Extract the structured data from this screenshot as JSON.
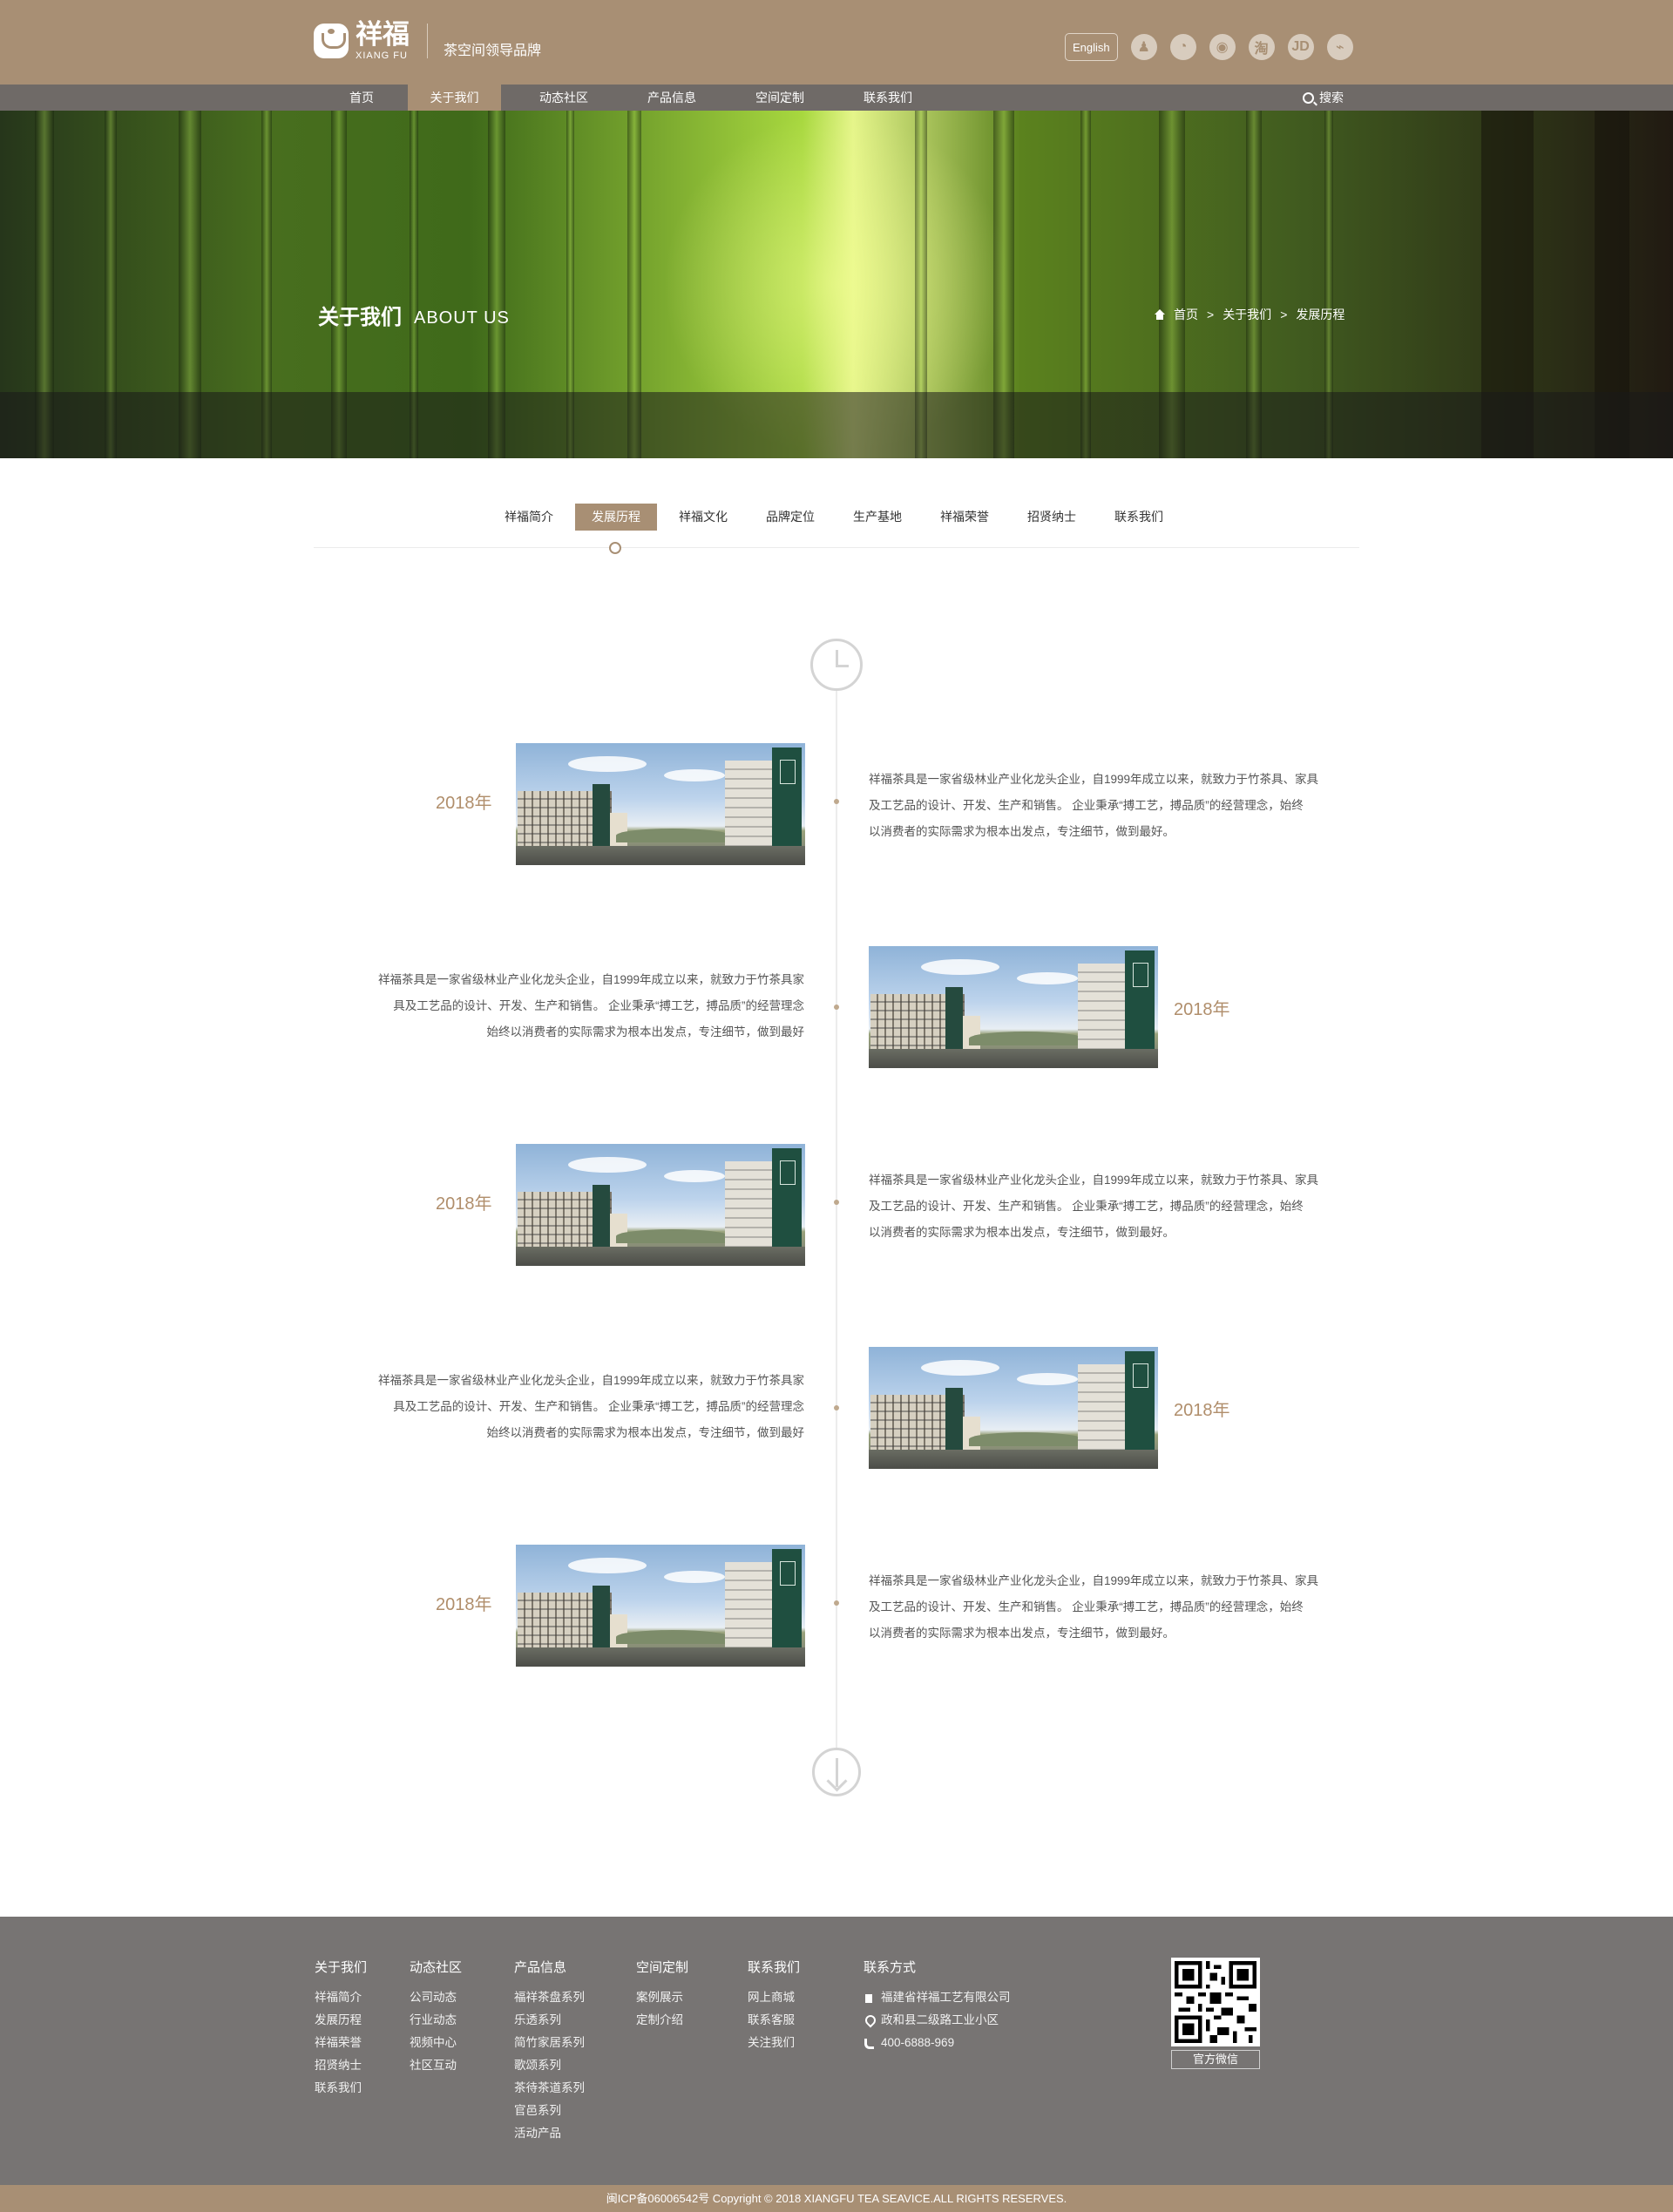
{
  "header": {
    "logo": {
      "name_cn": "祥福",
      "name_en": "XIANG FU",
      "mark": "®"
    },
    "slogan": "茶空间领导品牌",
    "english_button": "English",
    "social_icons": [
      {
        "name": "qq-icon",
        "glyph": "♟"
      },
      {
        "name": "wechat-icon",
        "glyph": "◔"
      },
      {
        "name": "weibo-icon",
        "glyph": "◉"
      },
      {
        "name": "taobao-icon",
        "glyph": "淘"
      },
      {
        "name": "jd-icon",
        "glyph": "JD"
      },
      {
        "name": "store-icon",
        "glyph": "⌁"
      }
    ]
  },
  "nav": {
    "items": [
      "首页",
      "关于我们",
      "动态社区",
      "产品信息",
      "空间定制",
      "联系我们"
    ],
    "active_index": 1,
    "search_label": "搜索"
  },
  "hero": {
    "title": "关于我们",
    "subtitle": "ABOUT US",
    "breadcrumb": [
      "首页",
      "关于我们",
      "发展历程"
    ],
    "breadcrumb_separator": ">"
  },
  "subtabs": {
    "items": [
      "祥福简介",
      "发展历程",
      "祥福文化",
      "品牌定位",
      "生产基地",
      "祥福荣誉",
      "招贤纳士",
      "联系我们"
    ],
    "active_index": 1
  },
  "timeline": {
    "entries": [
      {
        "year": "2018年",
        "lines": [
          "祥福茶具是一家省级林业产业化龙头企业，自1999年成立以来，就致力于竹茶具、家具",
          "及工艺品的设计、开发、生产和销售。 企业秉承“搏工艺，搏品质”的经营理念，始终",
          "以消费者的实际需求为根本出发点，专注细节，做到最好。"
        ]
      },
      {
        "year": "2018年",
        "lines": [
          "祥福茶具是一家省级林业产业化龙头企业，自1999年成立以来，就致力于竹茶具家",
          "具及工艺品的设计、开发、生产和销售。 企业秉承“搏工艺，搏品质”的经营理念",
          "始终以消费者的实际需求为根本出发点，专注细节，做到最好"
        ]
      },
      {
        "year": "2018年",
        "lines": [
          "祥福茶具是一家省级林业产业化龙头企业，自1999年成立以来，就致力于竹茶具、家具",
          "及工艺品的设计、开发、生产和销售。 企业秉承“搏工艺，搏品质”的经营理念，始终",
          "以消费者的实际需求为根本出发点，专注细节，做到最好。"
        ]
      },
      {
        "year": "2018年",
        "lines": [
          "祥福茶具是一家省级林业产业化龙头企业，自1999年成立以来，就致力于竹茶具家",
          "具及工艺品的设计、开发、生产和销售。 企业秉承“搏工艺，搏品质”的经营理念",
          "始终以消费者的实际需求为根本出发点，专注细节，做到最好"
        ]
      },
      {
        "year": "2018年",
        "lines": [
          "祥福茶具是一家省级林业产业化龙头企业，自1999年成立以来，就致力于竹茶具、家具",
          "及工艺品的设计、开发、生产和销售。 企业秉承“搏工艺，搏品质”的经营理念，始终",
          "以消费者的实际需求为根本出发点，专注细节，做到最好。"
        ]
      }
    ]
  },
  "footer": {
    "columns": [
      {
        "title": "关于我们",
        "links": [
          "祥福简介",
          "发展历程",
          "祥福荣誉",
          "招贤纳士",
          "联系我们"
        ]
      },
      {
        "title": "动态社区",
        "links": [
          "公司动态",
          "行业动态",
          "视频中心",
          "社区互动"
        ]
      },
      {
        "title": "产品信息",
        "links": [
          "福祥茶盘系列",
          "乐透系列",
          "简竹家居系列",
          "歌颂系列",
          "茶待茶道系列",
          "官邑系列",
          "活动产品"
        ]
      },
      {
        "title": "空间定制",
        "links": [
          "案例展示",
          "定制介绍"
        ]
      },
      {
        "title": "联系我们",
        "links": [
          "网上商城",
          "联系客服",
          "关注我们"
        ]
      }
    ],
    "contact": {
      "title": "联系方式",
      "company": "福建省祥福工艺有限公司",
      "address": "政和县二级路工业小区",
      "phone": "400-6888-969"
    },
    "qr_label": "官方微信",
    "copyright": "闽ICP备06006542号 Copyright © 2018 XIANGFU TEA SEAVICE.ALL RIGHTS RESERVES."
  },
  "colors": {
    "brand": "#a88f74",
    "nav": "#6f6a67",
    "footer": "#777473",
    "year": "#b08e6b"
  }
}
